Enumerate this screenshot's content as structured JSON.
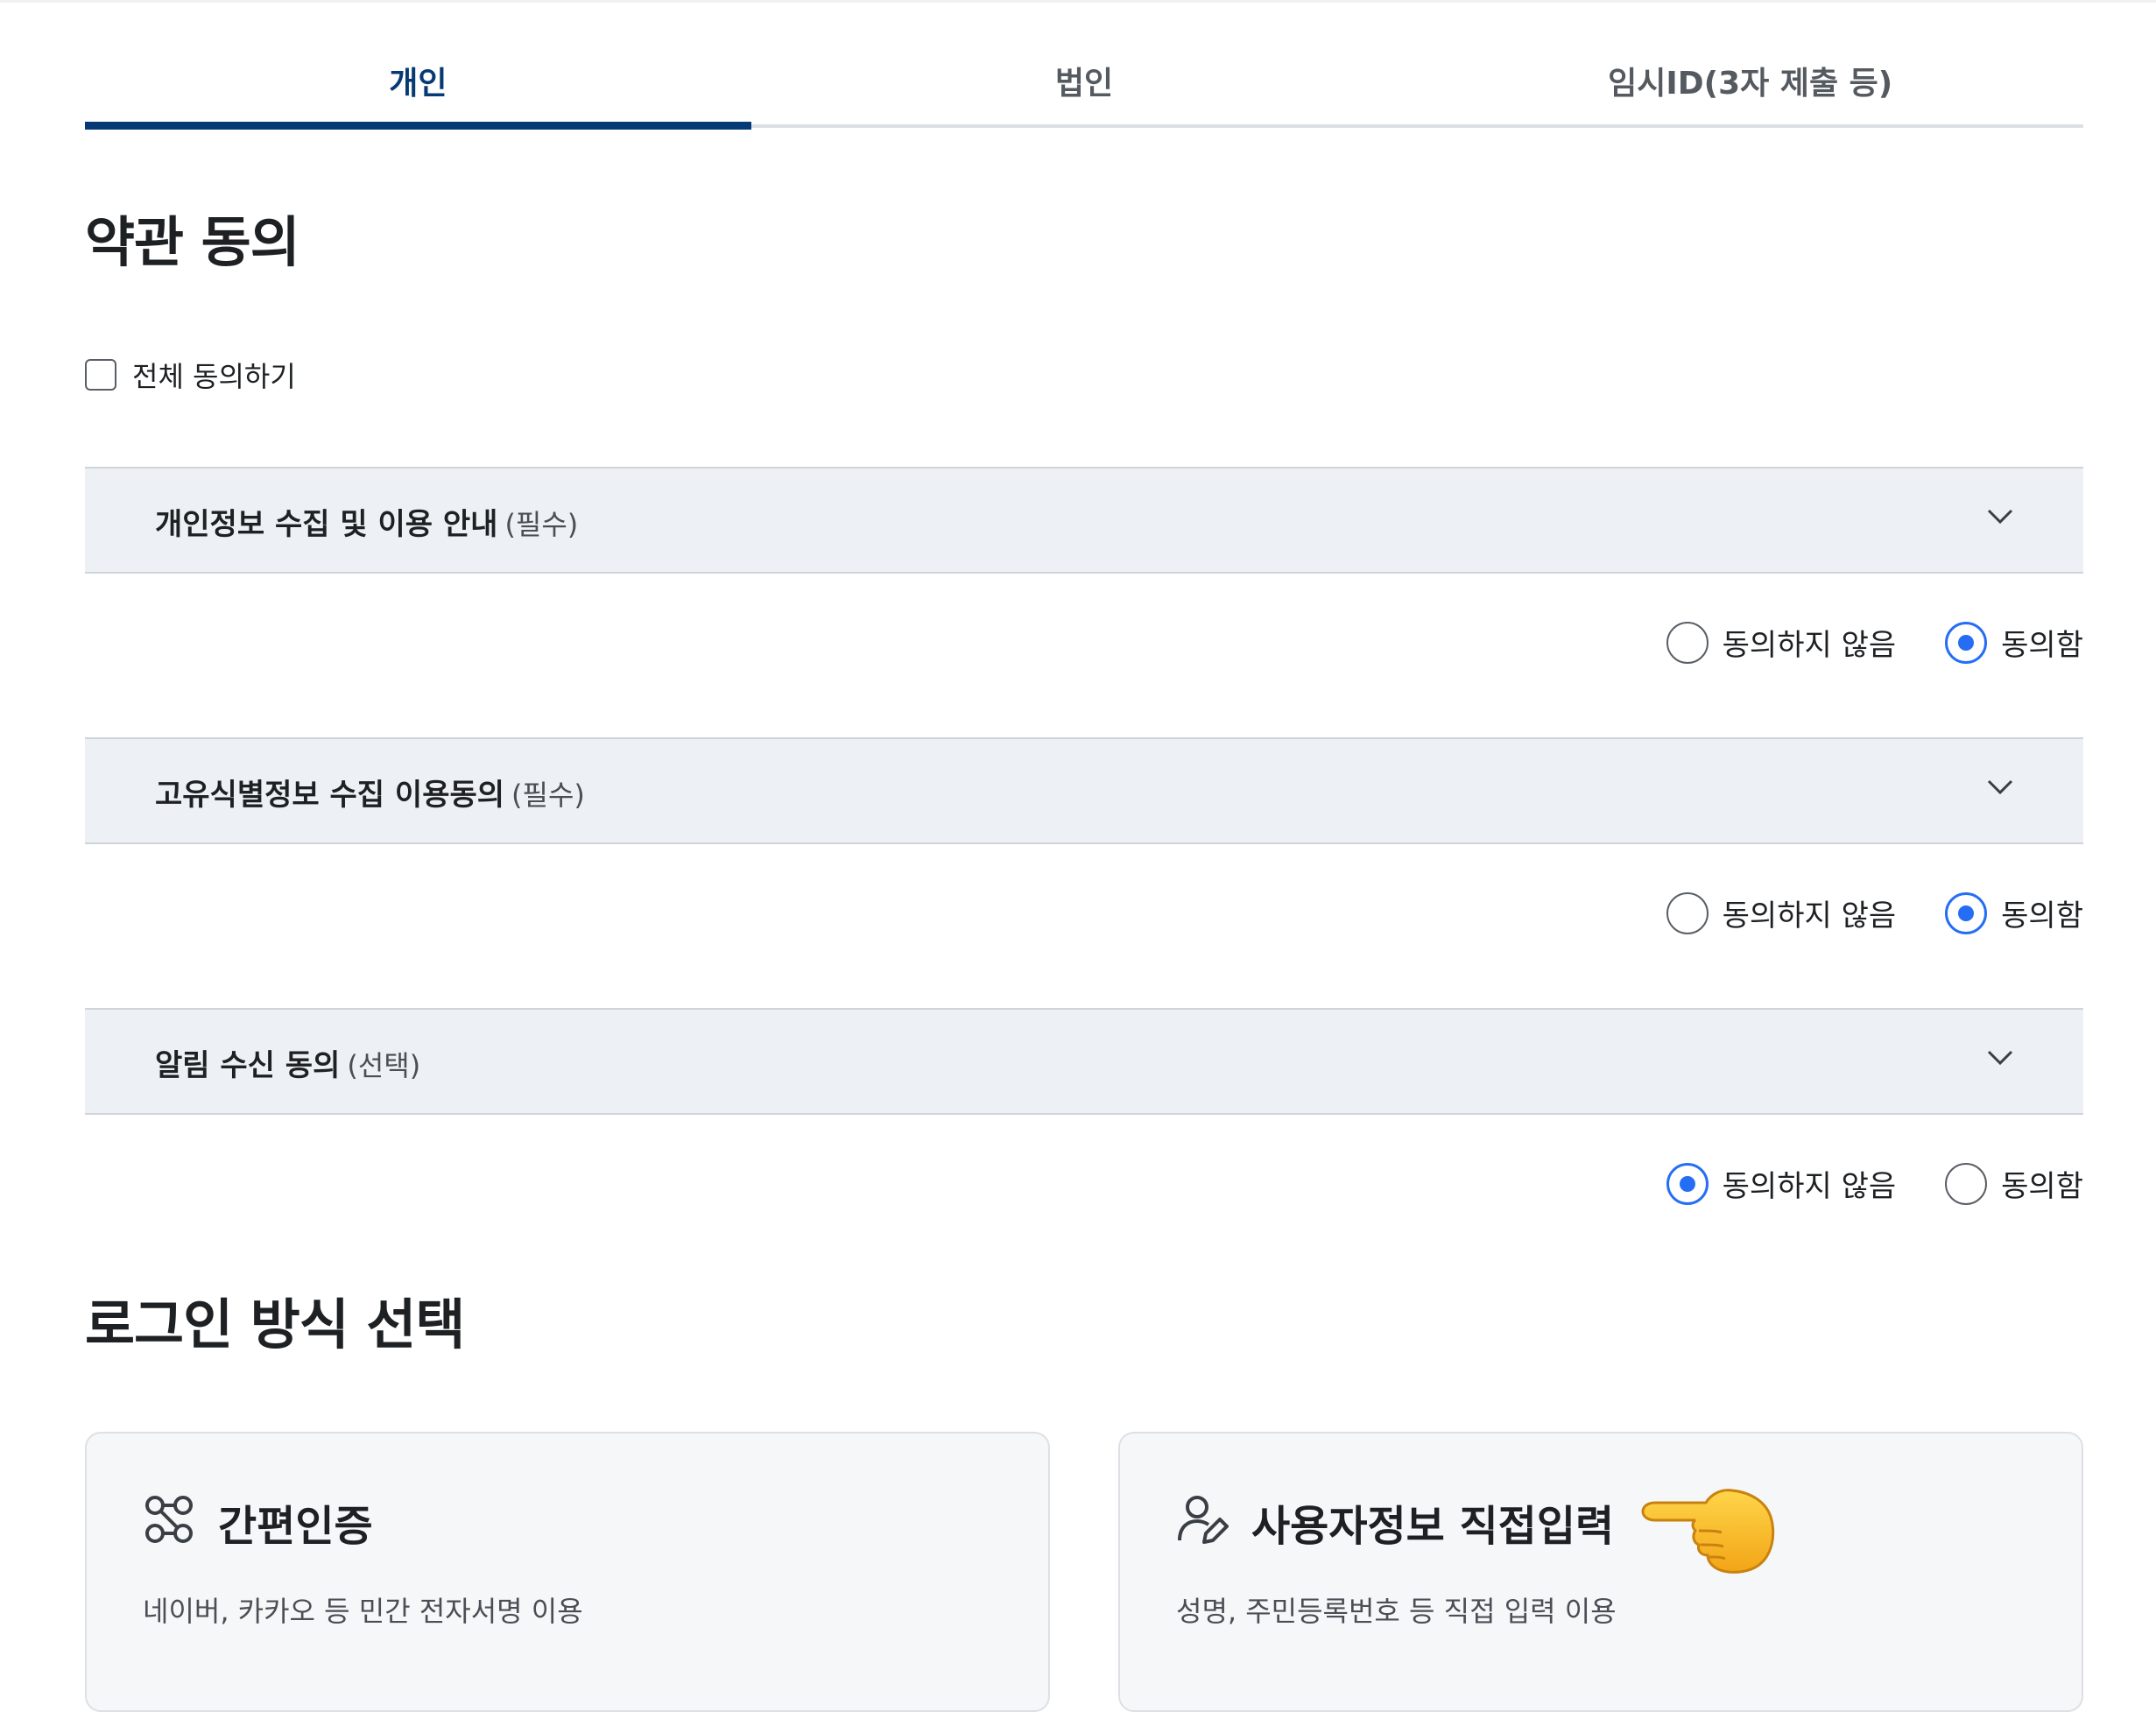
{
  "tabs": [
    {
      "label": "개인",
      "active": true
    },
    {
      "label": "법인",
      "active": false
    },
    {
      "label": "임시ID(3자 제출 등)",
      "active": false
    }
  ],
  "terms": {
    "title": "약관 동의",
    "all_agree_label": "전체 동의하기",
    "all_agree_checked": false,
    "items": [
      {
        "title": "개인정보 수집 및 이용 안내",
        "tag": "(필수)",
        "disagree_label": "동의하지 않음",
        "agree_label": "동의함",
        "selected": "agree"
      },
      {
        "title": "고유식별정보 수집 이용동의",
        "tag": "(필수)",
        "disagree_label": "동의하지 않음",
        "agree_label": "동의함",
        "selected": "agree"
      },
      {
        "title": "알림 수신 동의",
        "tag": "(선택)",
        "disagree_label": "동의하지 않음",
        "agree_label": "동의함",
        "selected": "disagree"
      }
    ]
  },
  "login": {
    "title": "로그인 방식 선택",
    "cards": [
      {
        "title": "간편인증",
        "desc": "네이버, 카카오 등 민간 전자서명 이용",
        "icon": "connection-icon"
      },
      {
        "title": "사용자정보 직접입력",
        "desc": "성명, 주민등록번호 등 직접 입력 이용",
        "icon": "user-edit-icon"
      }
    ]
  },
  "colors": {
    "active_tab": "#063a74",
    "radio_checked": "#256ef4",
    "accordion_bg": "#edf0f4"
  }
}
